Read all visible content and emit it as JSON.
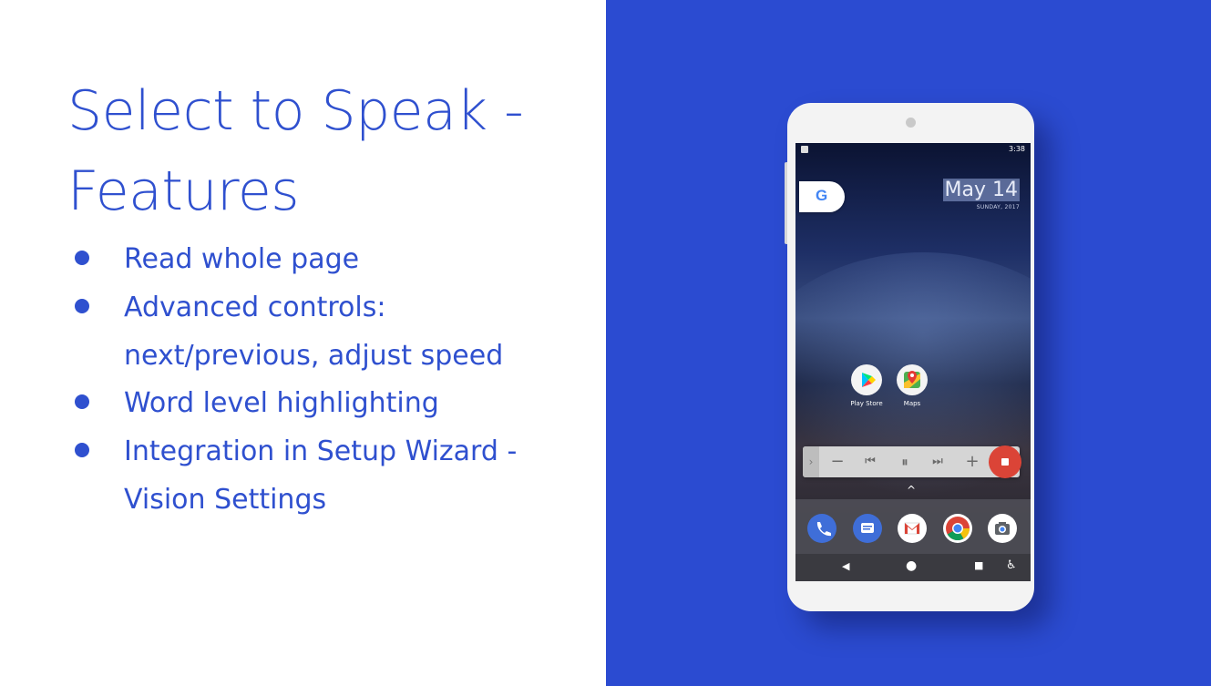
{
  "slide": {
    "title_line1": "Select to Speak -",
    "title_line2": "Features",
    "bullets": [
      {
        "lines": [
          "Read whole page"
        ]
      },
      {
        "lines": [
          "Advanced controls:",
          "next/previous, adjust speed"
        ]
      },
      {
        "lines": [
          "Word level highlighting"
        ]
      },
      {
        "lines": [
          "Integration in Setup Wizard -",
          "Vision Settings"
        ]
      }
    ],
    "accent_color": "#2f50cf",
    "panel_color": "#2b4bd1"
  },
  "phone": {
    "status_time": "3:38",
    "date": "May 14",
    "subdate": "SUNDAY, 2017",
    "search_pill_letter": "G",
    "apps": [
      {
        "label": "Play Store",
        "icon": "play-store-icon"
      },
      {
        "label": "Maps",
        "icon": "maps-icon"
      }
    ],
    "controls": {
      "expand": "›",
      "slower": "−",
      "previous": "⏮",
      "pause": "⏸",
      "next": "⏭",
      "faster": "+"
    },
    "dock_icons": [
      "phone-icon",
      "messages-icon",
      "gmail-icon",
      "chrome-icon",
      "camera-icon"
    ],
    "nav": {
      "back": "◀",
      "home": "●",
      "recents": "■",
      "accessibility": "♿"
    }
  }
}
